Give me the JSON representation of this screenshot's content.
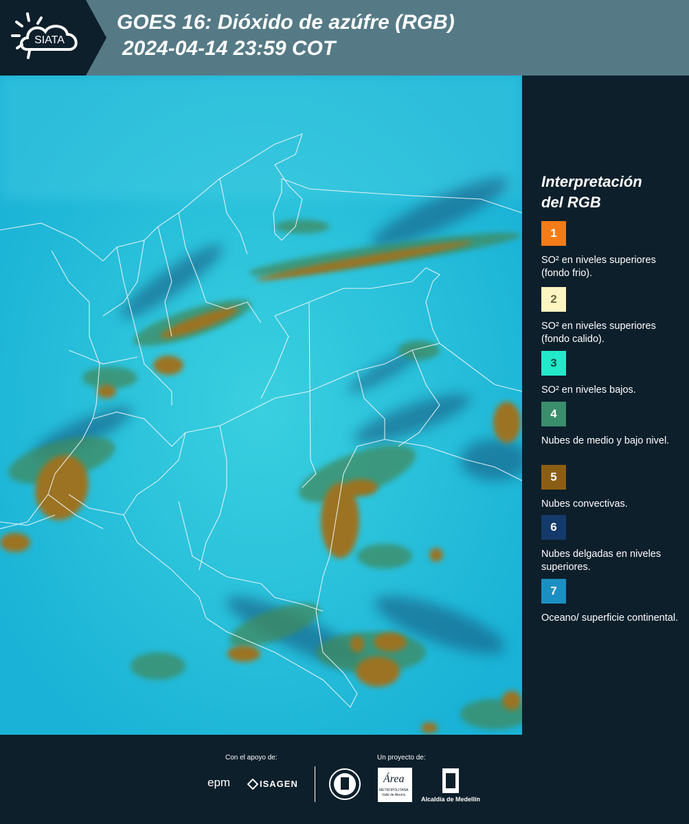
{
  "header": {
    "logo_text": "SIATA",
    "title_line1": "GOES 16: Dióxido de azúfre (RGB)",
    "title_line2": "2024-04-14 23:59 COT",
    "bg_color": "#557a86"
  },
  "legend": {
    "title_line1": "Interpretación",
    "title_line2": "del RGB",
    "items": [
      {
        "num": "1",
        "text": "SO² en niveles superiores (fondo frio).",
        "color": "#f47c16"
      },
      {
        "num": "2",
        "text": "SO² en niveles superiores (fondo calido).",
        "color": "#fcf5c2"
      },
      {
        "num": "3",
        "text": "SO² en niveles bajos.",
        "color": "#22e9c9"
      },
      {
        "num": "4",
        "text": "Nubes de medio y bajo nivel.",
        "color": "#3a8e6c"
      },
      {
        "num": "5",
        "text": "Nubes convectivas.",
        "color": "#8b5e15"
      },
      {
        "num": "6",
        "text": "Nubes delgadas en niveles superiores.",
        "color": "#143a6b"
      },
      {
        "num": "7",
        "text": "Oceano/ superficie continental.",
        "color": "#1c8fc2"
      }
    ]
  },
  "footer": {
    "support_caption": "Con el apoyo de:",
    "project_caption": "Un proyecto de:",
    "logos": {
      "epm": "epm",
      "isagen": "ISAGEN",
      "area": "Área",
      "area_sub1": "METROPOLITANA",
      "area_sub2": "Valle de Aburrá",
      "alcaldia": "Alcaldía de Medellín"
    }
  }
}
